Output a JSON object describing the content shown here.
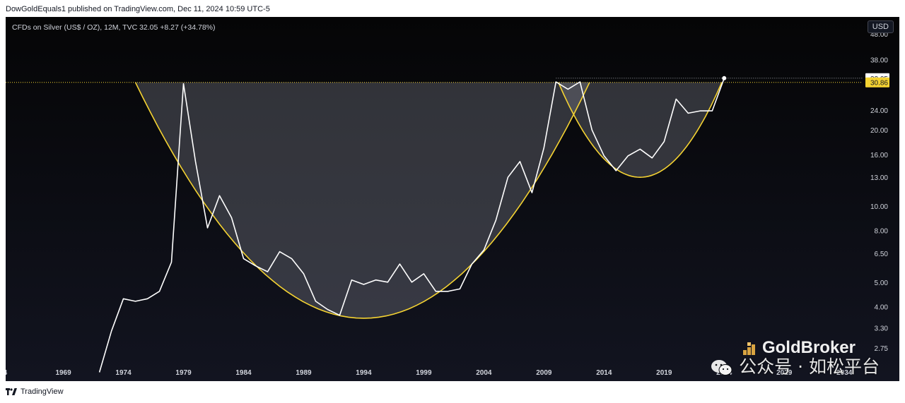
{
  "caption": "DowGoldEquals1 published on TradingView.com, Dec 11, 2024 10:59 UTC-5",
  "symbol_line": "CFDs on Silver (US$ / OZ), 12M, TVC  32.05  +8.27 (+34.78%)",
  "currency_button": "USD",
  "footer_brand": "TradingView",
  "watermark": {
    "brand": "GoldBroker",
    "wechat_text": "公众号 · 如松平台"
  },
  "colors": {
    "background": "#0b0c10",
    "price_line": "#ffffff",
    "cup_line": "#f5d332",
    "cup_fill": "#787b86",
    "level_line": "#f5d332",
    "axis_text": "#d1d4dc"
  },
  "chart_data": {
    "type": "line",
    "title": "CFDs on Silver (US$ / OZ), 12M, TVC",
    "y_scale": "log",
    "ylim": [
      2.4,
      56
    ],
    "xlim": [
      1964.2,
      2035.4
    ],
    "x_ticks": [
      "64",
      "1969",
      "1974",
      "1979",
      "1984",
      "1989",
      "1994",
      "1999",
      "2004",
      "2009",
      "2014",
      "2019",
      "2024",
      "2029",
      "2034"
    ],
    "x_tick_values": [
      1964,
      1969,
      1974,
      1979,
      1984,
      1989,
      1994,
      1999,
      2004,
      2009,
      2014,
      2019,
      2024,
      2029,
      2034
    ],
    "y_ticks": [
      "48.00",
      "38.00",
      "24.00",
      "20.00",
      "16.00",
      "13.00",
      "10.00",
      "8.00",
      "6.50",
      "5.00",
      "4.00",
      "3.30",
      "2.75"
    ],
    "y_tick_values": [
      48,
      38,
      24,
      20,
      16,
      13,
      10,
      8,
      6.5,
      5,
      4,
      3.3,
      2.75
    ],
    "price_labels": [
      {
        "label": "32.05",
        "value": 32.05
      },
      {
        "label": "30.86",
        "value": 30.86
      }
    ],
    "series": [
      {
        "x": [
          1972,
          1973,
          1974,
          1975,
          1976,
          1977,
          1978,
          1979,
          1980,
          1981,
          1982,
          1983,
          1984,
          1985,
          1986,
          1987,
          1988,
          1989,
          1990,
          1991,
          1992,
          1993,
          1994,
          1995,
          1996,
          1997,
          1998,
          1999,
          2000,
          2001,
          2002,
          2003,
          2004,
          2005,
          2006,
          2007,
          2008,
          2009,
          2010,
          2011,
          2012,
          2013,
          2014,
          2015,
          2016,
          2017,
          2018,
          2019,
          2020,
          2021,
          2022,
          2023,
          2024
        ],
        "values": [
          2.2,
          3.2,
          4.3,
          4.2,
          4.3,
          4.6,
          6.0,
          30.5,
          15.0,
          8.2,
          11.0,
          9.0,
          6.2,
          5.8,
          5.5,
          6.6,
          6.2,
          5.4,
          4.2,
          3.9,
          3.7,
          5.1,
          4.9,
          5.1,
          5.0,
          5.9,
          5.0,
          5.4,
          4.6,
          4.6,
          4.7,
          5.9,
          6.7,
          8.8,
          13.0,
          15.0,
          11.3,
          17.0,
          31.0,
          29.0,
          31.0,
          20.0,
          15.8,
          13.8,
          15.8,
          16.8,
          15.5,
          18.0,
          26.5,
          23.3,
          23.8,
          23.8,
          32.05
        ]
      }
    ],
    "annotations": [
      {
        "type": "horizontal_level",
        "value": 30.86
      },
      {
        "type": "cup_arc",
        "start": [
          1975.0,
          30.86
        ],
        "bottom": [
          1994.0,
          3.6
        ],
        "end": [
          2012.8,
          30.86
        ]
      },
      {
        "type": "cup_arc",
        "start": [
          2010.2,
          30.86
        ],
        "bottom": [
          2017.0,
          13.0
        ],
        "end": [
          2023.8,
          30.86
        ]
      }
    ]
  }
}
